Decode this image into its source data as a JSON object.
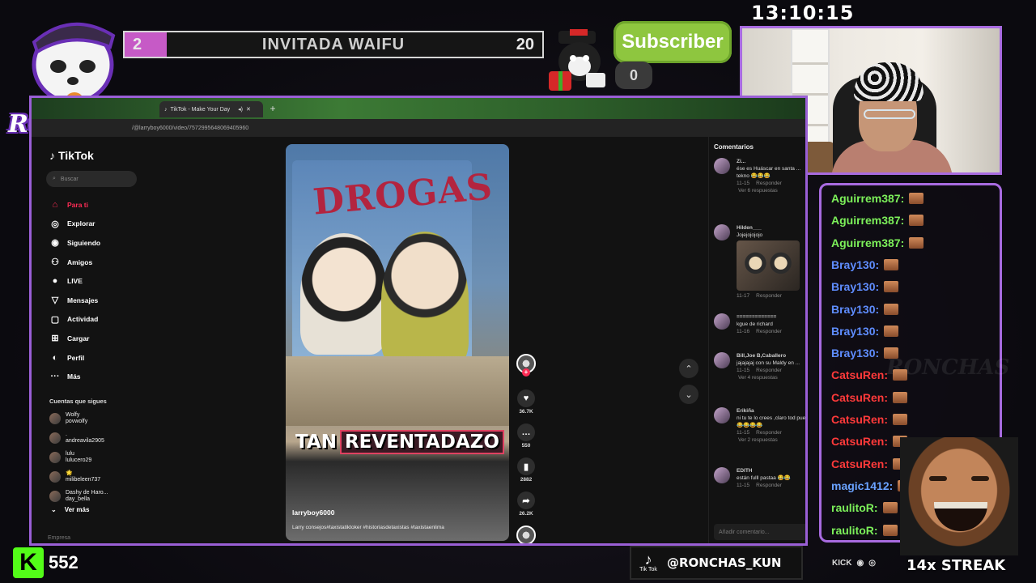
{
  "overlay": {
    "clock": "13:10:15",
    "logo_text": "RONCHAS",
    "goal": {
      "current": "2",
      "title": "INVITADA WAIFU",
      "target": "20",
      "progress_fraction": 0.1
    },
    "subscriber": {
      "label": "Subscriber",
      "count": "0"
    },
    "kick": {
      "count": "552"
    },
    "tiktok_banner": {
      "icon_label": "Tik Tok",
      "handle": "@RONCHAS_KUN"
    },
    "streak": "14x STREAK",
    "socials_label": "KICK",
    "chat_watermark": "RONCHAS"
  },
  "browser": {
    "tab_title": "TikTok - Make Your Day",
    "url": "/@larryboy6000/video/7572995648069405960"
  },
  "tiktok": {
    "logo": "TikTok",
    "search_placeholder": "Buscar",
    "nav": [
      {
        "icon": "home-icon",
        "glyph": "⌂",
        "label": "Para ti",
        "active": true
      },
      {
        "icon": "compass-icon",
        "glyph": "◎",
        "label": "Explorar",
        "active": false
      },
      {
        "icon": "following-avatar-icon",
        "glyph": "◉",
        "label": "Siguiendo",
        "active": false
      },
      {
        "icon": "friends-icon",
        "glyph": "⚇",
        "label": "Amigos",
        "active": false
      },
      {
        "icon": "live-icon",
        "glyph": "●",
        "label": "LIVE",
        "active": false
      },
      {
        "icon": "messages-icon",
        "glyph": "▽",
        "label": "Mensajes",
        "active": false
      },
      {
        "icon": "activity-icon",
        "glyph": "▢",
        "label": "Actividad",
        "active": false
      },
      {
        "icon": "upload-icon",
        "glyph": "⊞",
        "label": "Cargar",
        "active": false
      },
      {
        "icon": "profile-icon",
        "glyph": "◐",
        "label": "Perfil",
        "active": false
      },
      {
        "icon": "more-icon",
        "glyph": "···",
        "label": "Más",
        "active": false
      }
    ],
    "following_header": "Cuentas que sigues",
    "following": [
      {
        "name": "Wolfy",
        "handle": "povwolfy"
      },
      {
        "name": ".",
        "handle": "andreavila2905"
      },
      {
        "name": "lulu",
        "handle": "lulucero29"
      },
      {
        "name": "🌟",
        "handle": "milibeleen737"
      },
      {
        "name": "Dashy de Haro...",
        "handle": "day_bella"
      }
    ],
    "see_more": "Ver más",
    "company": "Empresa",
    "video": {
      "mural_text": "DROGAS",
      "caption_a": "TAN",
      "caption_b": "REVENTADAZO",
      "author": "larryboy6000",
      "description": "Larry consejos#taxistatiktoker #historiasdetaxistas #taxistaenlima"
    },
    "actions": {
      "likes": "36.7K",
      "comments": "550",
      "saves": "2882",
      "shares": "26.2K"
    },
    "comments_header": "Comentarios",
    "comments": [
      {
        "name": "Zi...",
        "text": "ése es Huáscar en santa ... tekno 😂😂😂",
        "date": "11-15",
        "reply": "Responder",
        "replies": "Ver 6 respuestas"
      },
      {
        "name": "Hilden___",
        "text": "Jojejojojojo",
        "date": "11-17",
        "reply": "Responder",
        "replies": ""
      },
      {
        "name": "=============",
        "text": "kgue de richard",
        "date": "11-16",
        "reply": "Responder",
        "replies": ""
      },
      {
        "name": "Bill,Joe B,Caballero",
        "text": "jajajajaj con su Maldy en ...",
        "date": "11-15",
        "reply": "Responder",
        "replies": "Ver 4 respuestas"
      },
      {
        "name": "Erikiña",
        "text": "ni tu te lo crees ,claro tod pues 😂😂😂😂",
        "date": "11-15",
        "reply": "Responder",
        "replies": "Ver 2 respuestas"
      },
      {
        "name": "EDITH",
        "text": "están fulll pastaa 😂😂",
        "date": "11-15",
        "reply": "Responder",
        "replies": ""
      }
    ],
    "comment_placeholder": "Añadir comentario..."
  },
  "chat": [
    {
      "user": "Aguirrem387:",
      "color": "#7cf05a"
    },
    {
      "user": "Aguirrem387:",
      "color": "#7cf05a"
    },
    {
      "user": "Aguirrem387:",
      "color": "#7cf05a"
    },
    {
      "user": "Bray130:",
      "color": "#5f8dff"
    },
    {
      "user": "Bray130:",
      "color": "#5f8dff"
    },
    {
      "user": "Bray130:",
      "color": "#5f8dff"
    },
    {
      "user": "Bray130:",
      "color": "#5f8dff"
    },
    {
      "user": "Bray130:",
      "color": "#5f8dff"
    },
    {
      "user": "CatsuRen:",
      "color": "#ff3a3a"
    },
    {
      "user": "CatsuRen:",
      "color": "#ff3a3a"
    },
    {
      "user": "CatsuRen:",
      "color": "#ff3a3a"
    },
    {
      "user": "CatsuRen:",
      "color": "#ff3a3a"
    },
    {
      "user": "CatsuRen:",
      "color": "#ff3a3a"
    },
    {
      "user": "magic1412:",
      "color": "#6aa2ff"
    },
    {
      "user": "raulitoR:",
      "color": "#7cf05a"
    },
    {
      "user": "raulitoR:",
      "color": "#7cf05a"
    }
  ]
}
